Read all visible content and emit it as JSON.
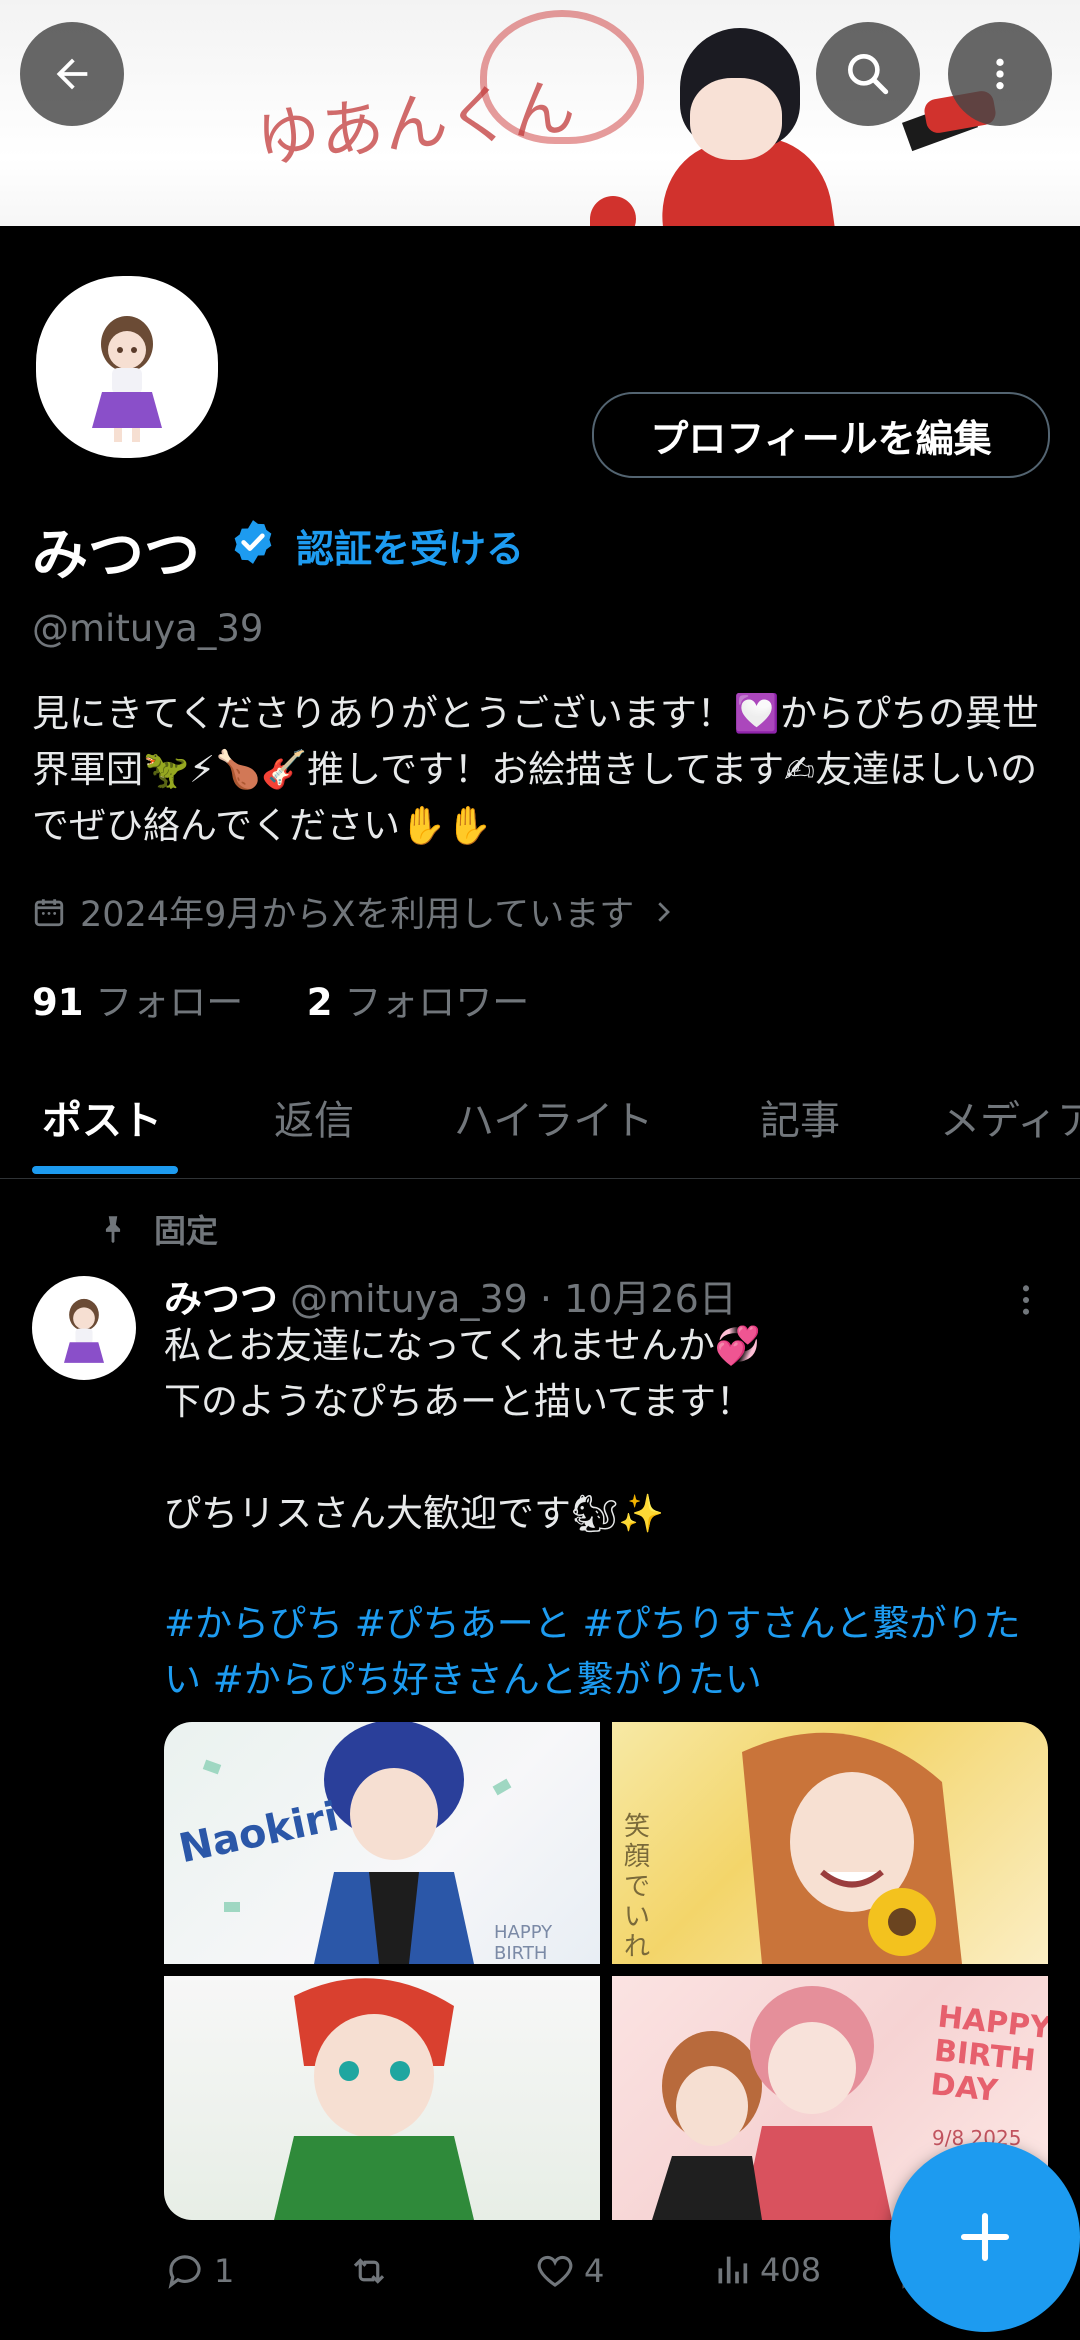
{
  "banner": {
    "text": "ゆあんくん"
  },
  "profile": {
    "name": "みつつ",
    "get_verified": "認証を受ける",
    "handle": "@mituya_39",
    "edit_profile": "プロフィールを編集",
    "bio": "見にきてくださりありがとうございます！💟からぴちの異世界軍団🦖⚡🍗🎸推しです！お絵描きしてます✍友達ほしいのでぜひ絡んでください✋✋",
    "joined": "2024年9月からXを利用しています",
    "following_count": "91",
    "following_label": "フォロー",
    "followers_count": "2",
    "followers_label": "フォロワー"
  },
  "tabs": [
    "ポスト",
    "返信",
    "ハイライト",
    "記事",
    "メディア"
  ],
  "post": {
    "pinned_label": "固定",
    "name": "みつつ",
    "handle": "@mituya_39",
    "date": "10月26日",
    "text": "私とお友達になってくれませんか💞\n下のようなぴちあーと描いてます！\n\nぴちリスさん大歓迎です🐿✨",
    "hashtags": "#からぴち #ぴちあーと #ぴちりすさんと繋がりたい #からぴち好きさんと繋がりたい",
    "images": [
      {
        "text": "Naokiri",
        "subtext": "HAPPY BIRTH"
      },
      {
        "text": "笑顔でいれますよ"
      },
      {
        "text": ""
      },
      {
        "text": "HAPPY BIRTH DAY",
        "subtext": "9/8 2025"
      }
    ],
    "replies": "1",
    "reposts": "",
    "likes": "4",
    "views": "408"
  },
  "colors": {
    "accent": "#1d9bf0",
    "muted": "#71767b",
    "background": "#000000"
  }
}
